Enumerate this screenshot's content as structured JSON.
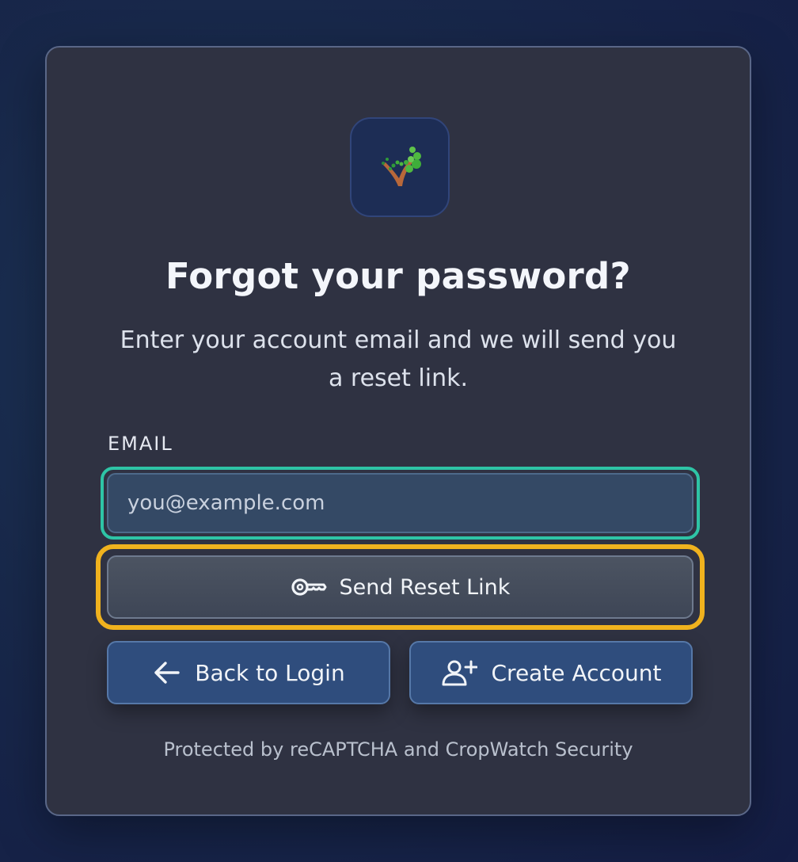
{
  "logo": {
    "icon": "tree-logo-icon"
  },
  "heading": {
    "title": "Forgot your password?",
    "subtitle": "Enter your account email and we will send you a reset link."
  },
  "form": {
    "email_label": "EMAIL",
    "email_value": "",
    "email_placeholder": "you@example.com",
    "submit_label": "Send Reset Link",
    "submit_icon": "key-icon"
  },
  "actions": {
    "back_label": "Back to Login",
    "back_icon": "arrow-left-icon",
    "create_label": "Create Account",
    "create_icon": "user-plus-icon"
  },
  "footer": {
    "text": "Protected by reCAPTCHA and CropWatch Security"
  },
  "colors": {
    "input_focus_ring": "#2ec4a6",
    "button_focus_ring": "#f0b21e",
    "card_background": "#2f3242",
    "secondary_button": "#2f4d7d"
  }
}
